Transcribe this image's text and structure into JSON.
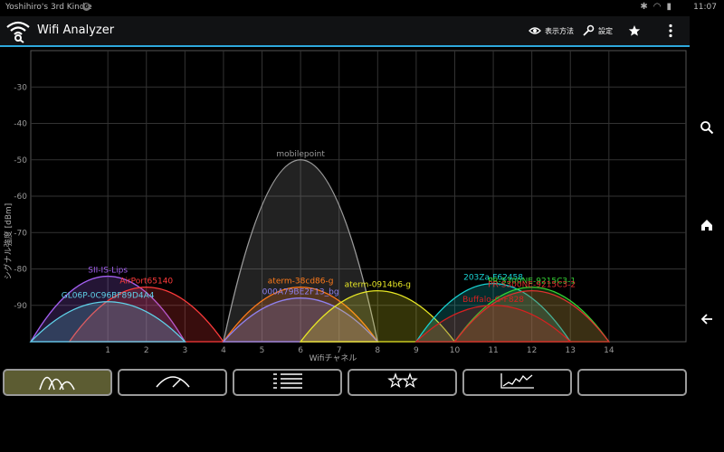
{
  "status_bar": {
    "device_name": "Yoshihiro's 3rd Kindle",
    "notification_count": "6",
    "time": "11:07"
  },
  "action_bar": {
    "title": "Wifi Analyzer",
    "view_label": "表示方法",
    "settings_label": "設定"
  },
  "toolbar": {
    "tabs": [
      {
        "name": "channel-graph",
        "icon": "channel-graph-icon",
        "active": true
      },
      {
        "name": "signal-meter",
        "icon": "meter-icon",
        "active": false
      },
      {
        "name": "ap-list",
        "icon": "list-icon",
        "active": false
      },
      {
        "name": "channel-rating",
        "icon": "stars-icon",
        "active": false
      },
      {
        "name": "time-graph",
        "icon": "time-graph-icon",
        "active": false
      },
      {
        "name": "empty",
        "icon": "",
        "active": false
      }
    ]
  },
  "chart_data": {
    "type": "area",
    "title": "",
    "xlabel": "Wifiチャネル",
    "ylabel": "シグナル強度 [dBm]",
    "xlim": [
      -1,
      16
    ],
    "ylim": [
      -100,
      -20
    ],
    "x_ticks": [
      1,
      2,
      3,
      4,
      5,
      6,
      7,
      8,
      9,
      10,
      11,
      12,
      13,
      14
    ],
    "y_ticks": [
      -30,
      -40,
      -50,
      -60,
      -70,
      -80,
      -90
    ],
    "grid": true,
    "series": [
      {
        "name": "mobilepoint",
        "channel": 6,
        "signal": -50,
        "color": "#9a9a9a"
      },
      {
        "name": "SII-IS-Lips",
        "channel": 1,
        "signal": -82,
        "color": "#a35ff0"
      },
      {
        "name": "AirPort65140",
        "channel": 2,
        "signal": -85,
        "color": "#ff3b3b"
      },
      {
        "name": "GL06P-0C96BF89D4A4",
        "channel": 1,
        "signal": -89,
        "color": "#5fd3ea"
      },
      {
        "name": "aterm-38cd86-g",
        "channel": 6,
        "signal": -85,
        "color": "#ff7a1a"
      },
      {
        "name": "000A79BE2F13_bg",
        "channel": 6,
        "signal": -88,
        "color": "#8f80ee"
      },
      {
        "name": "aterm-0914b6-g",
        "channel": 8,
        "signal": -86,
        "color": "#e8e825"
      },
      {
        "name": "203Za-F62458",
        "channel": 11,
        "signal": -84,
        "color": "#19d3d3"
      },
      {
        "name": "PR-S300NE-9215C3-1",
        "channel": 12,
        "signal": -85,
        "color": "#35d435"
      },
      {
        "name": "PR-S300NE-9215C3-2",
        "channel": 12,
        "signal": -86,
        "color": "#e03030"
      },
      {
        "name": "Buffalo-G-F828",
        "channel": 11,
        "signal": -90,
        "color": "#d82020"
      }
    ]
  }
}
